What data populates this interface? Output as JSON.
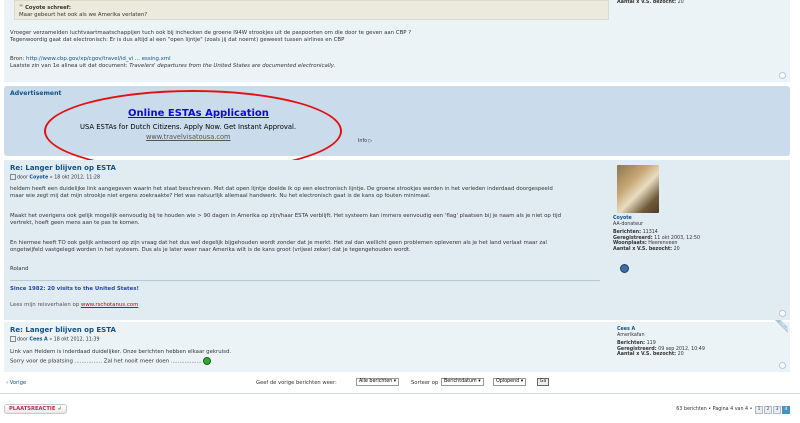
{
  "post1": {
    "quote_author": "Coyote schreef:",
    "quote_text": "Maar gebeurt het ook als we Amerika verlaten?",
    "para1_line1": "Vroeger verzamelden luchtvaartmaatschappijen tuch ook bij inchecken de groene I94W strookjes uit de paspoorten om die door te geven aan CBP ?",
    "para1_line2": "Tegenwoordig gaat dat electronisch: Er is dus altijd al een \"open lijntje\" (zoals jij dat noemt) geweest tussen airlines en CBP",
    "bron_label": "Bron:",
    "bron_link": "http://www.cbp.gov/xp/cgov/travel/id_vi ... essing.xml",
    "last_line_prefix": "Laatste zin van 1e alinea uit dat document:",
    "last_line_quote": "Travelers' departures from the United States are documented electronically.",
    "profile_line": "Aantal x V.S. bezocht:",
    "profile_value": "20"
  },
  "ad": {
    "label": "Advertisement",
    "title": "Online ESTAs Application",
    "desc": "USA ESTAs for Dutch Citizens. Apply Now. Get Instant Approval.",
    "url": "www.travelvisatousa.com",
    "info": "Info ▷"
  },
  "post2": {
    "title": "Re: Langer blijven op ESTA",
    "by": "door",
    "author": "Coyote",
    "date": "» 18 okt 2012, 11:28",
    "p1_l1": "heldem heeft een duidelijke link aangegeven waarin het staat beschreven. Met dat open lijntje doelde ik op een electronisch lijntje. De groene strookjes werden in het verleden inderdaad doorgespeeld",
    "p1_l2": "maar wie zegt mij dat mijn strookje niet ergens zoekraakte? Het was natuurlijk allemaal handwerk. Nu het electronisch gaat is de kans op fouten minimaal.",
    "p2_l1": "Maakt het overigens ook gelijk mogelijk eenvoudig bij te houden wie > 90 dagen in Amerika op zijn/haar ESTA verblijft. Het systeem kan immers eenvoudig een 'flag' plaatsen bij je naam als je niet op tijd",
    "p2_l2": "vertrekt, hoeft geen mens aan te pas te komen.",
    "p3_l1": "En hiermee heeft TO ook gelijk antwoord op zijn vraag dat het dus wel degelijk bijgehouden wordt zonder dat je merkt. Het zal dan wellicht geen problemen opleveren als je het land verlaat maar zal",
    "p3_l2": "ongetwijfeld vastgelegd worden in het systeem. Dus als je later weer naar Amerika wilt is de kans groot (vrijwel zeker) dat je tegengehouden wordt.",
    "sign": "Roland",
    "sig1": "Since 1982: 20 visits to the United States!",
    "sig2_prefix": "Lees mijn reisverhalen op",
    "sig2_link": "www.rschotanus.com",
    "profile": {
      "username": "Coyote",
      "rank": "AA-donateur",
      "berichten_label": "Berichten:",
      "berichten": "11314",
      "geregistreerd_label": "Geregistreerd:",
      "geregistreerd": "11 okt 2003, 12:50",
      "woonplaats_label": "Woonplaats:",
      "woonplaats": "Heerenveen",
      "bezocht_label": "Aantal x V.S. bezocht:",
      "bezocht": "20"
    }
  },
  "post3": {
    "title": "Re: Langer blijven op ESTA",
    "by": "door",
    "author": "Cees A",
    "date": "» 18 okt 2012, 11:39",
    "l1": "Link van Heldem is inderdaad duidelijker. Onze berichten hebben elkaar gekruisd.",
    "l2": "Sorry voor de plaatsing ................ Zal het nooit meer doen ..................",
    "online": "ONLINE",
    "profile": {
      "username": "Cees A",
      "rank": "Amerikafan",
      "berichten_label": "Berichten:",
      "berichten": "119",
      "geregistreerd_label": "Geregistreerd:",
      "geregistreerd": "09 sep 2012, 10:49",
      "bezocht_label": "Aantal x V.S. bezocht:",
      "bezocht": "20"
    }
  },
  "footer": {
    "prev": "‹ Vorige",
    "show_label": "Geef de vorige berichten weer:",
    "sel1": "Alle berichten",
    "sort_label": "Sorteer op",
    "sel2": "Berichtdatum",
    "sel3": "Oplopend",
    "go": "Ga",
    "reply": "PLAATSREACTIE",
    "summary": "63 berichten • Pagina 4 van 4 •",
    "pages": [
      "1",
      "2",
      "3",
      "4"
    ]
  }
}
